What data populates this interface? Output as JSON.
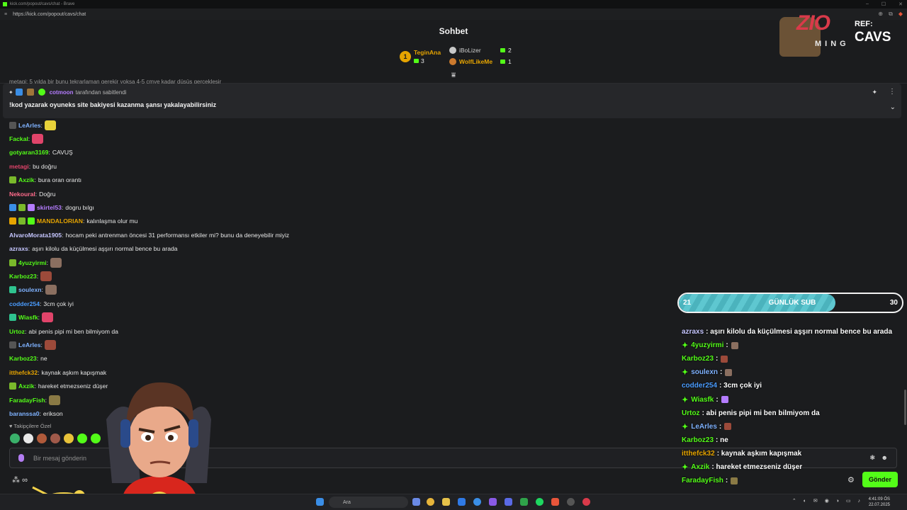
{
  "browser": {
    "window_title": "kick.com/popout/cavs/chat - Brave",
    "url": "https://kick.com/popout/cavs/chat"
  },
  "header": {
    "title": "Sohbet",
    "leaderboard": [
      {
        "rank": "1",
        "name": "TeginAna",
        "count": "3",
        "color": "#e6a400"
      },
      {
        "rank": "2",
        "name": "iBoLizer",
        "count": "2",
        "color": "#c8c8c8"
      },
      {
        "rank": "3",
        "name": "WolfLikeMe",
        "count": "1",
        "color": "#e6a400"
      }
    ]
  },
  "behind_text": "metagi: 5 yılda bir bunu tekrarlaman gerekir yoksa 4-5 cmye kadar düşüş gerçekleşir",
  "pinned": {
    "pinned_by": "cotmoon",
    "pinned_suffix": "tarafından sabitlendi",
    "message": "!kod yazarak oyuneks site bakiyesi kazanma şansı yakalayabilirsiniz"
  },
  "messages": [
    {
      "user": "LeArles",
      "text": "",
      "color": "#7fb2ff",
      "badges": [
        "#555"
      ],
      "emote": "#e8d23a"
    },
    {
      "user": "Fackal",
      "text": "",
      "color": "#53fc18",
      "badges": [],
      "emote": "#e0446a"
    },
    {
      "user": "gotyaran3169",
      "text": "CAVUŞ",
      "color": "#53fc18",
      "badges": [],
      "emote": ""
    },
    {
      "user": "metagi",
      "text": "bu doğru",
      "color": "#e0446a",
      "badges": [],
      "emote": ""
    },
    {
      "user": "Axzik",
      "text": "bura oran orantı",
      "color": "#53fc18",
      "badges": [
        "#7ab92b"
      ],
      "emote": ""
    },
    {
      "user": "Nekoural",
      "text": "Doğru",
      "color": "#ff6b8b",
      "badges": [],
      "emote": ""
    },
    {
      "user": "skirtel53",
      "text": "dogru bılgı",
      "color": "#b47cff",
      "badges": [
        "#3a8ee6",
        "#7ab92b",
        "#b47cff"
      ],
      "emote": ""
    },
    {
      "user": "MANDALORIAN",
      "text": "kalınlaşma olur mu",
      "color": "#e6a400",
      "badges": [
        "#e6a400",
        "#7ab92b",
        "#53fc18"
      ],
      "emote": ""
    },
    {
      "user": "AlvaroMorata1905",
      "text": "hocam peki antrenman öncesi 31 performansı etkiler mi? bunu da deneyebilir miyiz",
      "color": "#c6c6ff",
      "badges": [],
      "emote": ""
    },
    {
      "user": "azraxs",
      "text": "aşırı kilolu da küçülmesi aşşırı normal bence bu arada",
      "color": "#c6c6ff",
      "badges": [],
      "emote": ""
    },
    {
      "user": "4yuzyirmi",
      "text": "",
      "color": "#53fc18",
      "badges": [
        "#7ab92b"
      ],
      "emote": "#8b6f60"
    },
    {
      "user": "Karboz23",
      "text": "",
      "color": "#53fc18",
      "badges": [],
      "emote": "#9c4a3a"
    },
    {
      "user": "soulexn",
      "text": "",
      "color": "#7fb2ff",
      "badges": [
        "#2fc38f"
      ],
      "emote": "#8b6f60"
    },
    {
      "user": "codder254",
      "text": "3cm çok iyi",
      "color": "#4a9cff",
      "badges": [],
      "emote": ""
    },
    {
      "user": "Wiasfk",
      "text": "",
      "color": "#53fc18",
      "badges": [
        "#2fc38f"
      ],
      "emote": "#e0446a"
    },
    {
      "user": "Urtoz",
      "text": "abi penis pipi mi ben bilmiyom da",
      "color": "#53fc18",
      "badges": [],
      "emote": ""
    },
    {
      "user": "LeArles",
      "text": "",
      "color": "#7fb2ff",
      "badges": [
        "#555"
      ],
      "emote": "#9c4a3a"
    },
    {
      "user": "Karboz23",
      "text": "ne",
      "color": "#53fc18",
      "badges": [],
      "emote": ""
    },
    {
      "user": "itthefck32",
      "text": "kaynak aşkım kapışmak",
      "color": "#e6a400",
      "badges": [],
      "emote": ""
    },
    {
      "user": "Axzik",
      "text": "hareket etmezseniz düşer",
      "color": "#53fc18",
      "badges": [
        "#7ab92b"
      ],
      "emote": ""
    },
    {
      "user": "FaradayFish",
      "text": "",
      "color": "#53fc18",
      "badges": [],
      "emote": "#8a7a45"
    },
    {
      "user": "baranssa0",
      "text": "erikson",
      "color": "#7fb2ff",
      "badges": [],
      "emote": ""
    }
  ],
  "followers_emotes": {
    "label": "Takipçilere Özel",
    "colors": [
      "#3ab06a",
      "#e8e8e8",
      "#b05a3a",
      "#a05a4a",
      "#e8c23a",
      "#53fc18",
      "#53fc18"
    ]
  },
  "input": {
    "placeholder": "Bir mesaj gönderin",
    "send_label": "Gönder"
  },
  "overlay": {
    "logo_text": "ZIO",
    "logo_sub": "MING",
    "ref_label": "REF:",
    "ref_code": "CAVS",
    "sub_goal": {
      "label": "GÜNLÜK SUB",
      "current": 21,
      "target": 30,
      "current_text": "21",
      "target_text": "30"
    },
    "feed": [
      {
        "user": "azraxs",
        "text": ": aşırı kilolu da küçülmesi aşşırı normal bence bu arada",
        "color": "#c6c6ff",
        "star": false,
        "emote": ""
      },
      {
        "user": "4yuzyirmi",
        "text": ":",
        "color": "#53fc18",
        "star": true,
        "emote": "#8b6f60"
      },
      {
        "user": "Karboz23",
        "text": ":",
        "color": "#53fc18",
        "star": false,
        "emote": "#9c4a3a"
      },
      {
        "user": "soulexn",
        "text": ":",
        "color": "#7fb2ff",
        "star": true,
        "emote": "#8b6f60"
      },
      {
        "user": "codder254",
        "text": ": 3cm çok iyi",
        "color": "#4a9cff",
        "star": false,
        "emote": ""
      },
      {
        "user": "Wiasfk",
        "text": ":",
        "color": "#53fc18",
        "star": true,
        "emote": "#b47cff"
      },
      {
        "user": "Urtoz",
        "text": ": abi penis pipi mi ben bilmiyom da",
        "color": "#53fc18",
        "star": false,
        "emote": ""
      },
      {
        "user": "LeArles",
        "text": ":",
        "color": "#7fb2ff",
        "star": true,
        "emote": "#9c4a3a"
      },
      {
        "user": "Karboz23",
        "text": ": ne",
        "color": "#53fc18",
        "star": false,
        "emote": ""
      },
      {
        "user": "itthefck32",
        "text": ": kaynak aşkım kapışmak",
        "color": "#e6a400",
        "star": false,
        "emote": ""
      },
      {
        "user": "Axzik",
        "text": ": hareket etmezseniz düşer",
        "color": "#53fc18",
        "star": true,
        "emote": ""
      },
      {
        "user": "FaradayFish",
        "text": ":",
        "color": "#53fc18",
        "star": false,
        "emote": "#8a7a45"
      }
    ]
  },
  "taskbar": {
    "search_placeholder": "Ara",
    "time": "4:41:09 ÖS",
    "date": "22.07.2025"
  }
}
